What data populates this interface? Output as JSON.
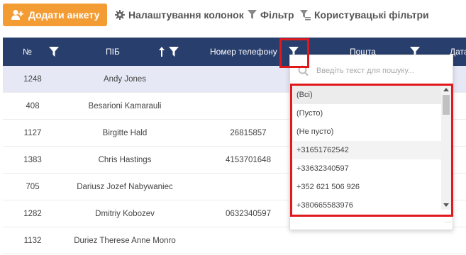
{
  "toolbar": {
    "add_label": "Додати анкету",
    "columns_label": "Налаштування колонок",
    "filter_label": "Фільтр",
    "user_filters_label": "Користувацькі фільтри"
  },
  "table": {
    "columns": {
      "num": "№",
      "name": "ПІБ",
      "phone": "Номер телефону",
      "email": "Пошта",
      "date": "Дата"
    },
    "rows": [
      {
        "num": "1248",
        "name": "Andy Jones",
        "phone": ""
      },
      {
        "num": "408",
        "name": "Besarioni Kamarauli",
        "phone": ""
      },
      {
        "num": "1127",
        "name": "Birgitte Hald",
        "phone": "26815857"
      },
      {
        "num": "1383",
        "name": "Chris Hastings",
        "phone": "4153701648"
      },
      {
        "num": "705",
        "name": "Dariusz Jozef Nabywaniec",
        "phone": ""
      },
      {
        "num": "1282",
        "name": "Dmitriy Kobozev",
        "phone": "0632340597"
      },
      {
        "num": "1132",
        "name": "Duriez Therese Anne Monro",
        "phone": ""
      }
    ]
  },
  "dropdown": {
    "search_placeholder": "Введіть текст для пошуку...",
    "options": [
      "(Всі)",
      "(Пусто)",
      "(Не пусто)",
      "+31651762542",
      "+33632340597",
      "+352 621 506 926",
      "+380665583976"
    ]
  },
  "colors": {
    "accent": "#f39c34",
    "header": "#283e6c",
    "highlight": "#e0191d",
    "selected_row": "#e6e8f5"
  }
}
